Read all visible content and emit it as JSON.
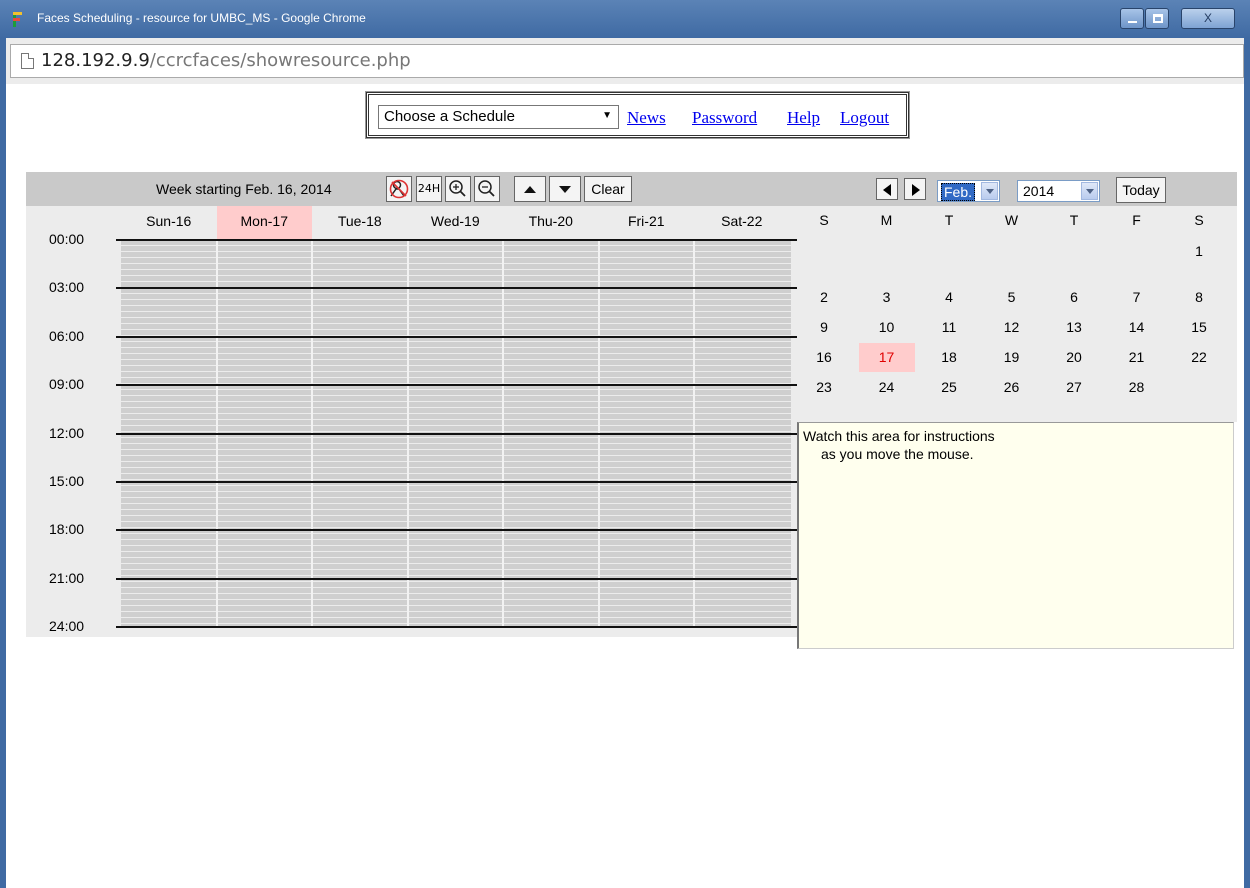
{
  "window": {
    "title": "Faces Scheduling - resource for UMBC_MS - Google Chrome",
    "close_label": "X"
  },
  "address": {
    "host": "128.192.9.9",
    "path": "/ccrcfaces/showresource.php"
  },
  "menu": {
    "schedule_select": "Choose a Schedule",
    "links": [
      "News",
      "Password",
      "Help",
      "Logout"
    ]
  },
  "week": {
    "label": "Week starting Feb. 16, 2014",
    "buttons": {
      "h24": "24H",
      "clear": "Clear"
    },
    "days": [
      "Sun-16",
      "Mon-17",
      "Tue-18",
      "Wed-19",
      "Thu-20",
      "Fri-21",
      "Sat-22"
    ],
    "today_index": 1,
    "hours": [
      "00:00",
      "03:00",
      "06:00",
      "09:00",
      "12:00",
      "15:00",
      "18:00",
      "21:00",
      "24:00"
    ]
  },
  "calendar": {
    "month": "Feb.",
    "year": "2014",
    "today_label": "Today",
    "weekdays": [
      "S",
      "M",
      "T",
      "W",
      "T",
      "F",
      "S"
    ],
    "weeks": [
      [
        "",
        "",
        "",
        "",
        "",
        "",
        "1"
      ],
      [
        "2",
        "3",
        "4",
        "5",
        "6",
        "7",
        "8"
      ],
      [
        "9",
        "10",
        "11",
        "12",
        "13",
        "14",
        "15"
      ],
      [
        "16",
        "17",
        "18",
        "19",
        "20",
        "21",
        "22"
      ],
      [
        "23",
        "24",
        "25",
        "26",
        "27",
        "28",
        ""
      ]
    ],
    "today_day": "17"
  },
  "info": {
    "line1": "Watch this area for instructions",
    "line2": "as you move the mouse."
  },
  "icons": {
    "no_person": "no-person-icon",
    "zoom_in": "zoom-in-icon",
    "zoom_out": "zoom-out-icon",
    "up": "up-arrow-icon",
    "down": "down-arrow-icon"
  }
}
